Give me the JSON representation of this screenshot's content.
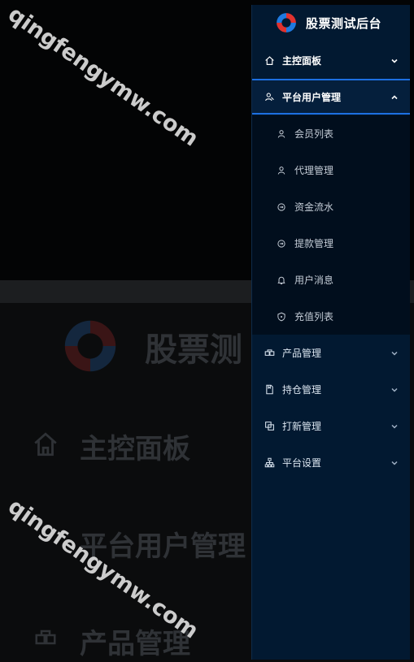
{
  "watermarks": [
    "qingfengymw.com",
    "qingfengymw.com"
  ],
  "brand": {
    "title": "股票测试后台",
    "logo_icon": "logo-ring-icon"
  },
  "colors": {
    "sidebar_bg": "#021931",
    "submenu_bg": "#010e1d",
    "accent": "#1d6fe0",
    "logo_red": "#e1322f",
    "logo_blue": "#1f7ae0"
  },
  "menu": [
    {
      "label": "主控面板",
      "icon": "home-icon",
      "expanded": false
    },
    {
      "label": "平台用户管理",
      "icon": "users-icon",
      "expanded": true,
      "children": [
        {
          "label": "会员列表",
          "icon": "user-icon"
        },
        {
          "label": "代理管理",
          "icon": "user-icon"
        },
        {
          "label": "资金流水",
          "icon": "refresh-icon"
        },
        {
          "label": "提款管理",
          "icon": "refresh-icon"
        },
        {
          "label": "用户消息",
          "icon": "bell-icon"
        },
        {
          "label": "充值列表",
          "icon": "shield-icon"
        }
      ]
    },
    {
      "label": "产品管理",
      "icon": "product-icon",
      "expanded": false
    },
    {
      "label": "持仓管理",
      "icon": "document-icon",
      "expanded": false
    },
    {
      "label": "打新管理",
      "icon": "copy-icon",
      "expanded": false
    },
    {
      "label": "平台设置",
      "icon": "sitemap-icon",
      "expanded": false
    }
  ],
  "background": {
    "title": "股票测",
    "items": [
      "主控面板",
      "平台用户管理",
      "产品管理"
    ]
  }
}
